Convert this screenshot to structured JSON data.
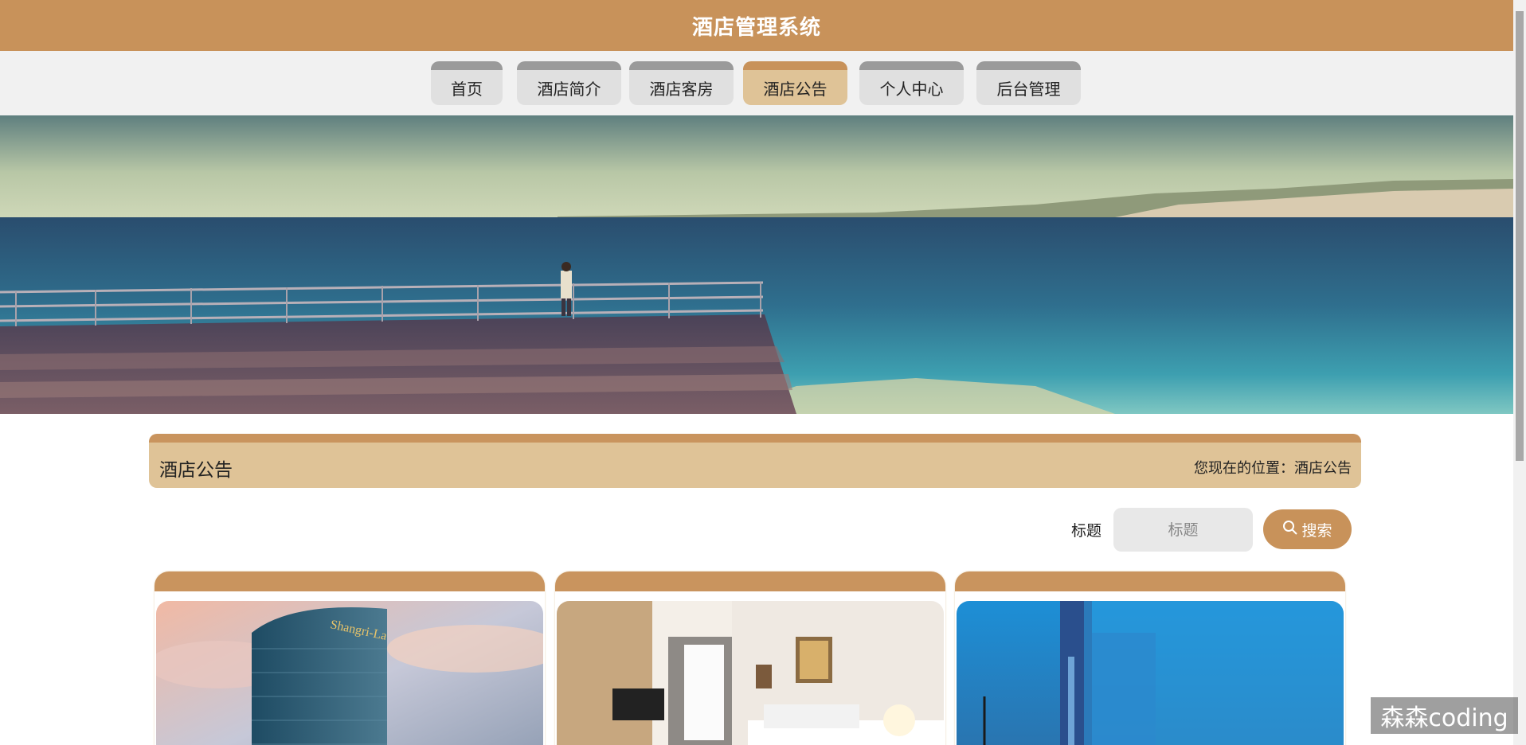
{
  "app": {
    "title": "酒店管理系统"
  },
  "nav": {
    "items": [
      {
        "label": "首页",
        "active": false
      },
      {
        "label": "酒店简介",
        "active": false
      },
      {
        "label": "酒店客房",
        "active": false
      },
      {
        "label": "酒店公告",
        "active": true
      },
      {
        "label": "个人中心",
        "active": false
      },
      {
        "label": "后台管理",
        "active": false
      }
    ]
  },
  "section": {
    "title": "酒店公告",
    "breadcrumb": "您现在的位置：酒店公告"
  },
  "search": {
    "label": "标题",
    "placeholder": "标题",
    "button_label": "搜索",
    "button_icon": "search-icon"
  },
  "cards": [
    {
      "image": "hotel-tower-image",
      "sign_text": "Shangri-La"
    },
    {
      "image": "hotel-room-image"
    },
    {
      "image": "blurred-building-image"
    }
  ],
  "watermark": "森森coding",
  "colors": {
    "brand": "#c8925a",
    "active_tab": "#dfc397",
    "nav_bg": "#f1f1f1"
  }
}
